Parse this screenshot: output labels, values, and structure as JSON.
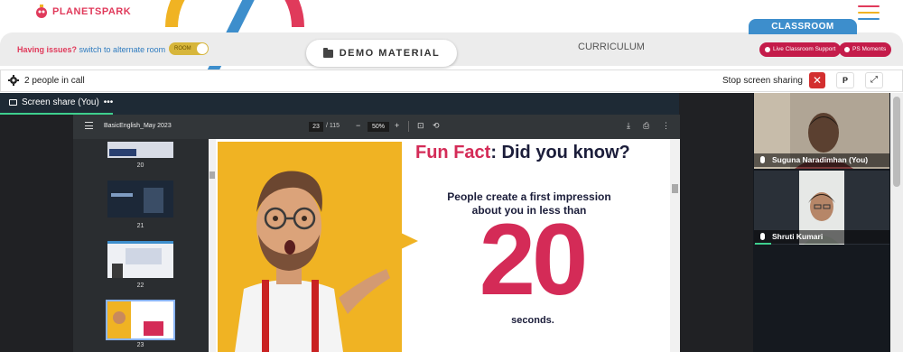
{
  "header": {
    "logo_text": "PLANETSPARK",
    "classroom_tab": "CLASSROOM",
    "menu_colors": [
      "#e03a5b",
      "#f0b323",
      "#3d8ecc"
    ]
  },
  "bar": {
    "issues_text": "Having issues?",
    "alt_room_link": "switch to alternate room",
    "toggle_label": "ROOM",
    "demo_material_label": "DEMO MATERIAL",
    "curriculum_label": "CURRICULUM",
    "live_support_label": "Live Classroom Support",
    "ps_moments_label": "PS Moments"
  },
  "call": {
    "people_in_call": "2 people in call",
    "stop_sharing_label": "Stop screen sharing",
    "p_button_label": "P"
  },
  "share": {
    "tab_label": "Screen share (You)",
    "tab_more": "•••"
  },
  "pdf": {
    "title": "BasicEnglish_May 2023",
    "current_page": "23",
    "total_pages": "/ 115",
    "zoom": "50%",
    "thumbnails": [
      {
        "number": "20"
      },
      {
        "number": "21"
      },
      {
        "number": "22"
      },
      {
        "number": "23"
      }
    ],
    "slide": {
      "fun_fact_pink": "Fun Fact",
      "fun_fact_rest": ": Did you know?",
      "impression_line1": "People create a first impression",
      "impression_line2": "about you in less than",
      "big_number": "20",
      "seconds": "seconds."
    }
  },
  "participants": [
    {
      "name": "Suguna Naradimhan (You)"
    },
    {
      "name": "Shruti Kumari"
    }
  ],
  "colors": {
    "brand_pink": "#e03a5b",
    "slide_pink": "#d42b57",
    "slide_yellow": "#f0b323",
    "classroom_blue": "#3d8ecc",
    "support_red": "#c41c4a",
    "speaking_green": "#3ecf8e"
  }
}
